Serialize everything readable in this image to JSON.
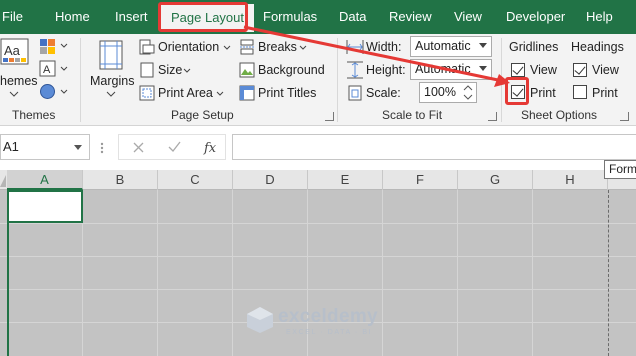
{
  "tabs": [
    "File",
    "Home",
    "Insert",
    "Page Layout",
    "Formulas",
    "Data",
    "Review",
    "View",
    "Developer",
    "Help"
  ],
  "active_tab": "Page Layout",
  "themes_group": {
    "themes_label": "hemes",
    "group_label": "Themes"
  },
  "page_setup_group": {
    "margins_label": "Margins",
    "orientation_label": "Orientation",
    "size_label": "Size",
    "print_area_label": "Print Area",
    "breaks_label": "Breaks",
    "background_label": "Background",
    "print_titles_label": "Print Titles",
    "group_label": "Page Setup"
  },
  "scale_group": {
    "width_label": "Width:",
    "width_value": "Automatic",
    "height_label": "Height:",
    "height_value": "Automatic",
    "scale_label": "Scale:",
    "scale_value": "100%",
    "group_label": "Scale to Fit"
  },
  "sheet_options_group": {
    "gridlines_label": "Gridlines",
    "gridlines_view_label": "View",
    "gridlines_view_checked": true,
    "gridlines_print_label": "Print",
    "gridlines_print_checked": true,
    "headings_label": "Headings",
    "headings_view_label": "View",
    "headings_view_checked": true,
    "headings_print_label": "Print",
    "headings_print_checked": false,
    "group_label": "Sheet Options"
  },
  "formula_bar": {
    "name_box": "A1",
    "tooltip": "Formu"
  },
  "columns": [
    "A",
    "B",
    "C",
    "D",
    "E",
    "F",
    "G",
    "H"
  ],
  "selected_column": "A",
  "watermark": {
    "name": "exceldemy",
    "tagline": "EXCEL · DATA · BI"
  },
  "colors": {
    "excel_green": "#217346",
    "highlight_red": "#e53935",
    "grid_gray": "#c3c3c3"
  }
}
